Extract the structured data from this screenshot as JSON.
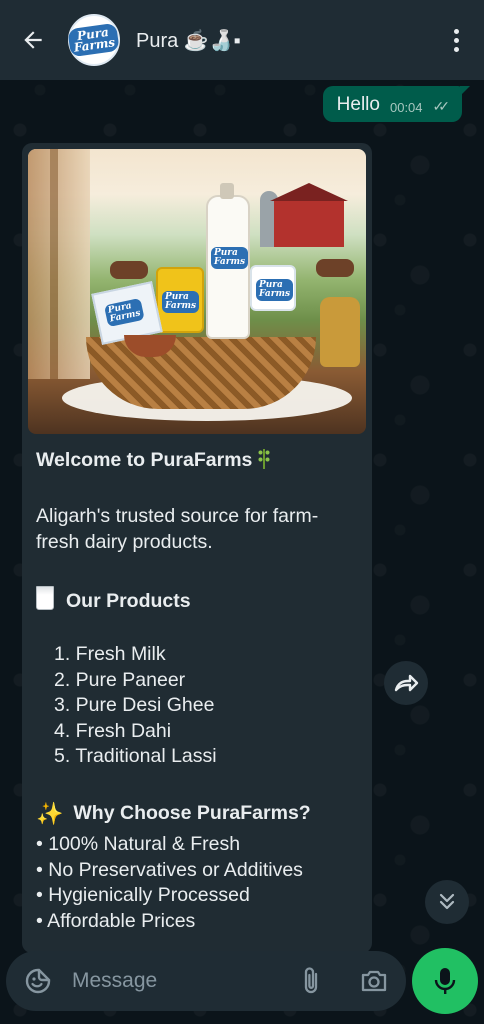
{
  "header": {
    "contact_name": "Pura ☕🍶▪",
    "avatar_logo_text": "Pura Farms"
  },
  "chat": {
    "outgoing": {
      "text": "Hello",
      "time": "00:04",
      "status": "read"
    },
    "incoming": {
      "image_description_label": "PuraFarms dairy products image",
      "welcome": "Welcome to PuraFarms",
      "intro": "Aligarh's trusted source for farm-fresh dairy products.",
      "products_heading": "Our Products",
      "products": [
        "1. Fresh Milk",
        "2. Pure Paneer",
        "3. Pure Desi Ghee",
        "4. Fresh Dahi",
        "5. Traditional Lassi"
      ],
      "why_heading": "Why Choose PuraFarms?",
      "why_points": [
        "• 100% Natural & Fresh",
        "• No Preservatives or Additives",
        "• Hygienically Processed",
        "• Affordable Prices"
      ]
    }
  },
  "composer": {
    "placeholder": "Message"
  },
  "icons": {
    "back": "arrow-left-icon",
    "menu": "more-vertical-icon",
    "forward": "forward-icon",
    "scroll_down": "double-chevron-down-icon",
    "emoji": "sticker-icon",
    "attach": "paperclip-icon",
    "camera": "camera-icon",
    "mic": "microphone-icon"
  },
  "colors": {
    "header_bg": "#1f2c34",
    "chat_bg": "#0b141a",
    "outgoing_bubble": "#005c4b",
    "incoming_bubble": "#202c33",
    "accent_green": "#21c063"
  }
}
